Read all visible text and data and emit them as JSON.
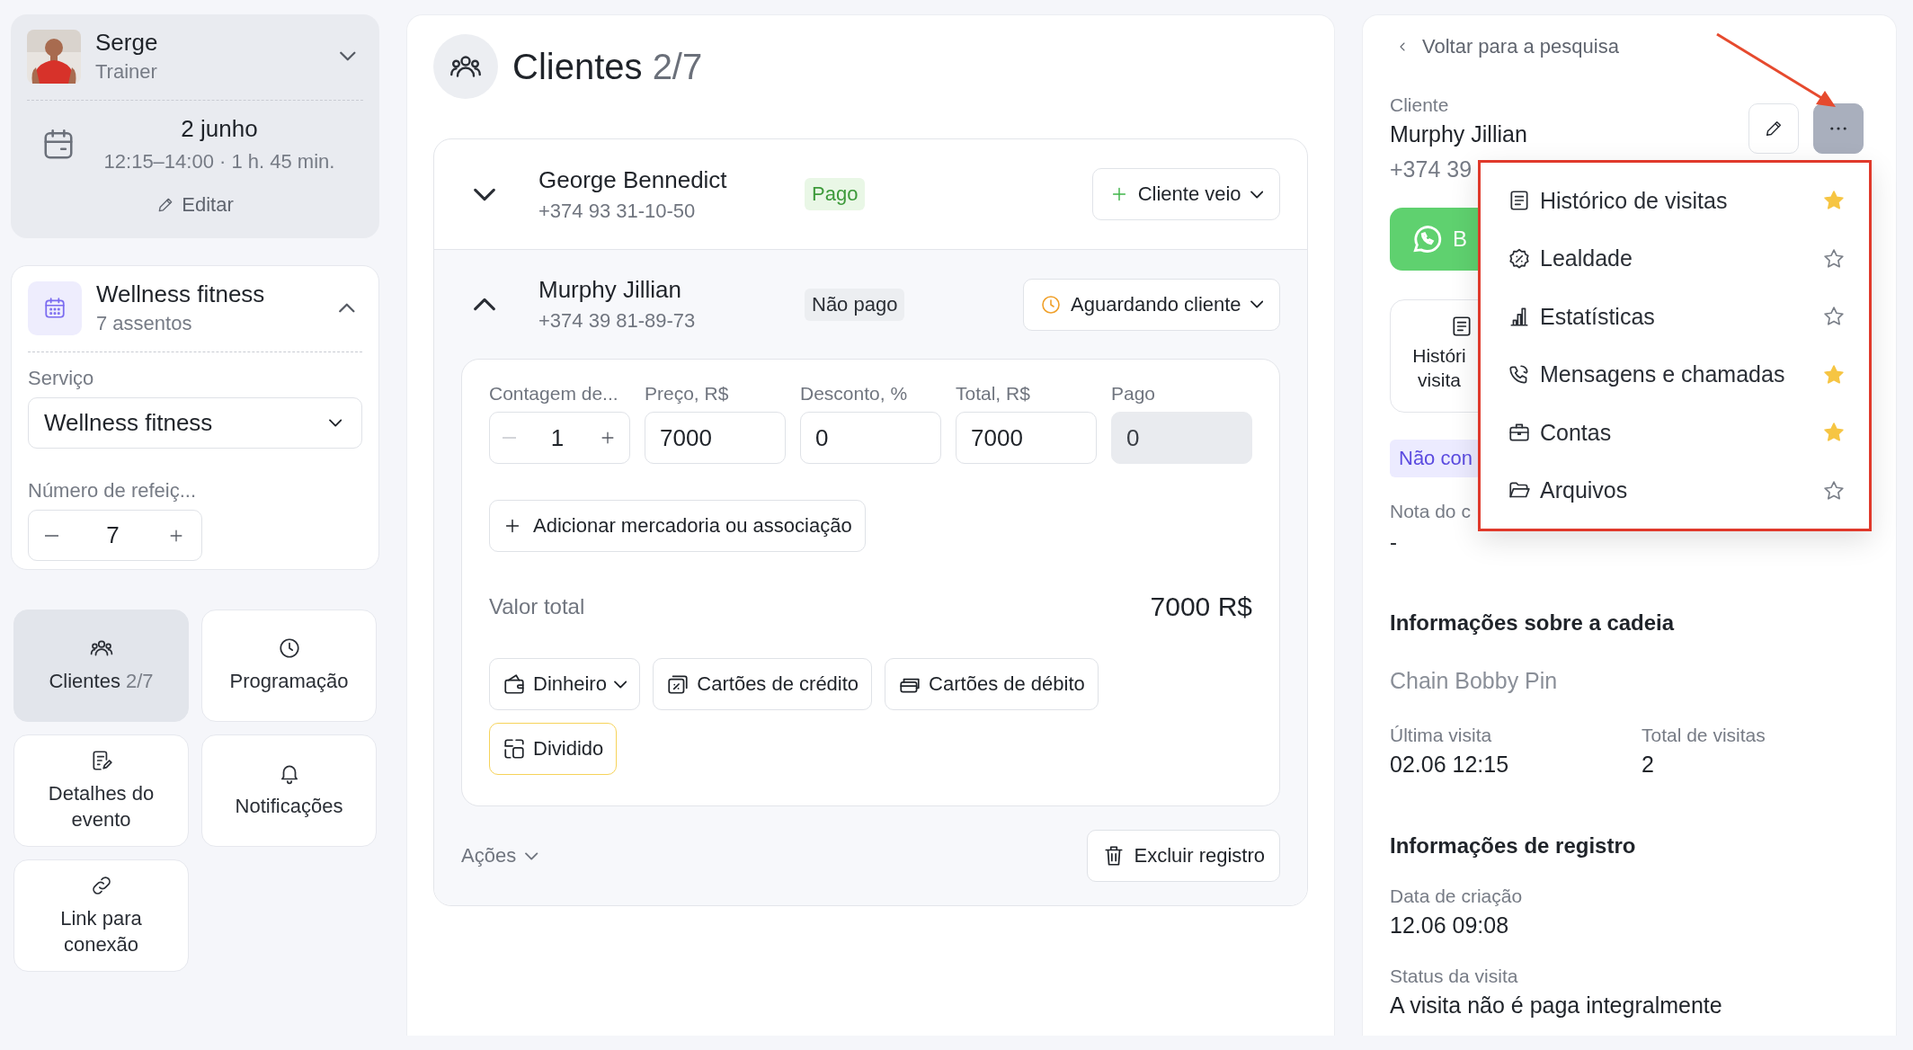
{
  "user": {
    "name": "Serge",
    "role": "Trainer"
  },
  "event": {
    "date": "2 junho",
    "time": "12:15–14:00 · 1 h. 45 min.",
    "edit": "Editar"
  },
  "service_card": {
    "title": "Wellness fitness",
    "subtitle": "7 assentos",
    "expanded": true,
    "service_label": "Serviço",
    "service_value": "Wellness fitness",
    "meals_label": "Número de refeiç...",
    "meals_value": "7"
  },
  "nav": [
    {
      "label": "Clientes",
      "count": "2/7",
      "selected": true
    },
    {
      "label": "Programação",
      "selected": false
    },
    {
      "label": "Detalhes do evento",
      "selected": false
    },
    {
      "label": "Notificações",
      "selected": false
    },
    {
      "label": "Link para conexão",
      "selected": false
    }
  ],
  "clients_panel": {
    "title": "Clientes",
    "count": "2/7"
  },
  "clients": [
    {
      "name": "George Bennedict",
      "phone": "+374 93 31-10-50",
      "payment": "Pago",
      "paid": true,
      "expanded": false,
      "status": "Cliente veio",
      "arrived": true
    },
    {
      "name": "Murphy Jillian",
      "phone": "+374 39 81-89-73",
      "payment": "Não pago",
      "paid": false,
      "expanded": true,
      "status": "Aguardando cliente",
      "arrived": false
    }
  ],
  "order": {
    "fields": [
      {
        "kind": "stepper",
        "label": "Contagem de...",
        "value": "1",
        "decrement_disabled": true
      },
      {
        "kind": "input",
        "label": "Preço, R$",
        "value": "7000",
        "readonly": false
      },
      {
        "kind": "input",
        "label": "Desconto, %",
        "value": "0",
        "readonly": false
      },
      {
        "kind": "input",
        "label": "Total, R$",
        "value": "7000",
        "readonly": false
      },
      {
        "kind": "input",
        "label": "Pago",
        "value": "0",
        "readonly": true
      }
    ],
    "add_button": "Adicionar mercadoria ou associação",
    "total_label": "Valor total",
    "total_value": "7000 R$",
    "payment_methods": [
      {
        "kind": "cash",
        "label": "Dinheiro",
        "dropdown": true,
        "selected": false
      },
      {
        "kind": "credit",
        "label": "Cartões de crédito",
        "dropdown": false,
        "selected": false
      },
      {
        "kind": "debit",
        "label": "Cartões de débito",
        "dropdown": false,
        "selected": false
      },
      {
        "kind": "split",
        "label": "Dividido",
        "dropdown": false,
        "selected": true
      }
    ],
    "actions": "Ações",
    "delete_button": "Excluir registro"
  },
  "details": {
    "back": "Voltar para a pesquisa",
    "client_label": "Cliente",
    "client_name": "Murphy Jillian",
    "phone": "+374 39",
    "whatsapp": "B",
    "history_tile": "Históri visita",
    "tag": "Não con",
    "note_label": "Nota do c",
    "note_value": "-",
    "chain_heading": "Informações sobre a cadeia",
    "chain_name": "Chain Bobby Pin",
    "stats": [
      {
        "label": "Última visita",
        "value": "02.06 12:15"
      },
      {
        "label": "Total de visitas",
        "value": "2"
      }
    ],
    "registration_heading": "Informações de registro",
    "registration": [
      {
        "label": "Data de criação",
        "value": "12.06 09:08"
      },
      {
        "label": "Status da visita",
        "value": "A visita não é paga integralmente"
      }
    ]
  },
  "menu": {
    "open": true,
    "items": [
      {
        "label": "Histórico de visitas",
        "starred": true
      },
      {
        "label": "Lealdade",
        "starred": false
      },
      {
        "label": "Estatísticas",
        "starred": false
      },
      {
        "label": "Mensagens e chamadas",
        "starred": true
      },
      {
        "label": "Contas",
        "starred": true
      },
      {
        "label": "Arquivos",
        "starred": false
      }
    ]
  }
}
